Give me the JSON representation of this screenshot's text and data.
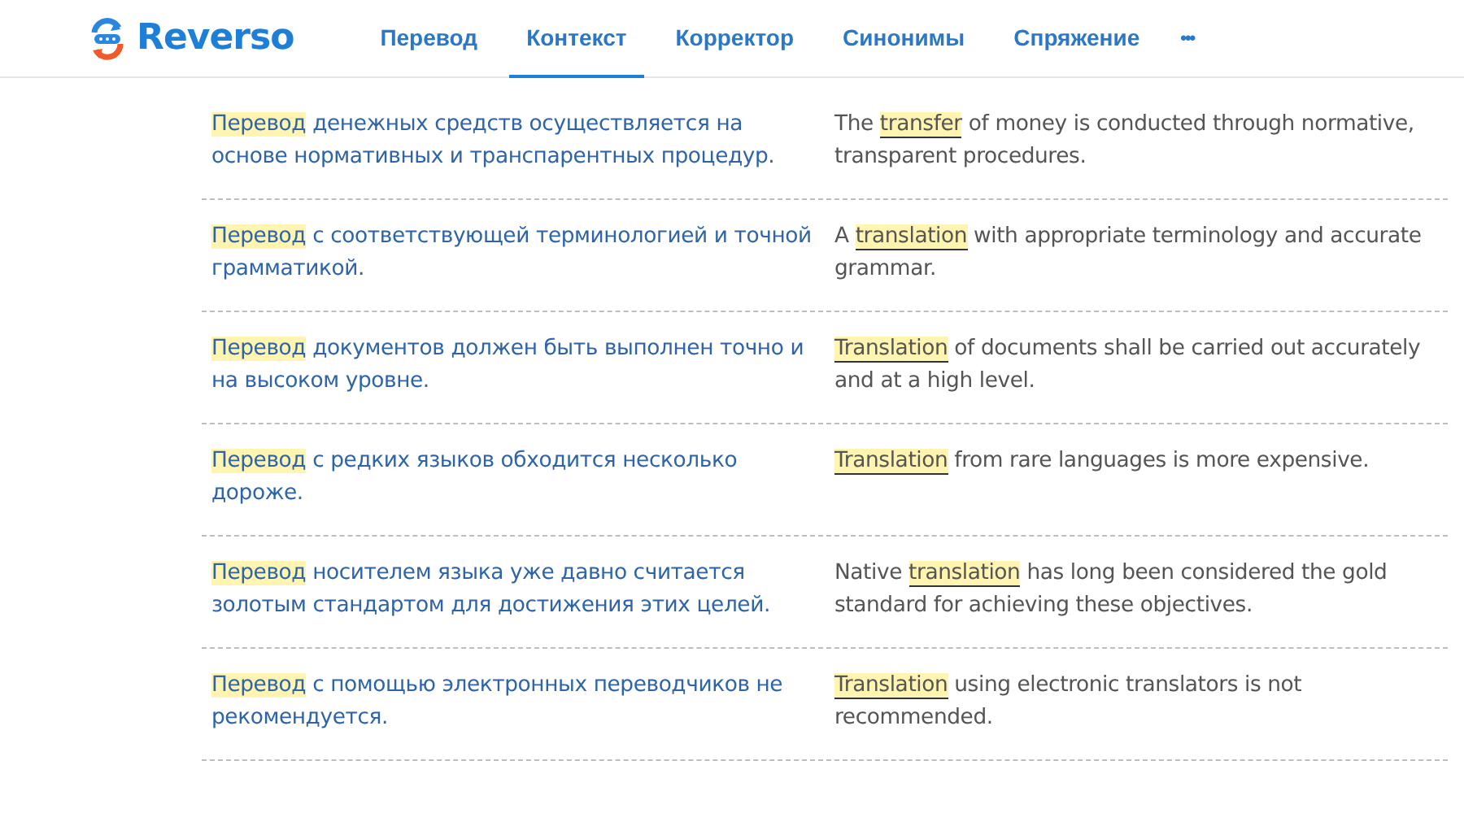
{
  "header": {
    "logo": "Reverso",
    "tabs": [
      {
        "label": "Перевод",
        "selected": false
      },
      {
        "label": "Контекст",
        "selected": true
      },
      {
        "label": "Корректор",
        "selected": false
      },
      {
        "label": "Синонимы",
        "selected": false
      },
      {
        "label": "Спряжение",
        "selected": false
      }
    ],
    "more": "•••"
  },
  "examples": [
    {
      "source": {
        "term": "Перевод",
        "after": " денежных средств осуществляется на основе нормативных и транспарентных процедур."
      },
      "target": {
        "before": "The ",
        "term": "transfer",
        "after": " of money is conducted through normative, transparent procedures."
      }
    },
    {
      "source": {
        "term": "Перевод",
        "after": " с соответствующей терминологией и точной грамматикой."
      },
      "target": {
        "before": "A ",
        "term": "translation",
        "after": " with appropriate terminology and accurate grammar."
      }
    },
    {
      "source": {
        "term": "Перевод",
        "after": " документов должен быть выполнен точно и на высоком уровне."
      },
      "target": {
        "term": "Translation",
        "after": " of documents shall be carried out accurately and at a high level."
      }
    },
    {
      "source": {
        "term": "Перевод",
        "after": " с редких языков обходится несколько дороже."
      },
      "target": {
        "term": "Translation",
        "after": " from rare languages is more expensive."
      }
    },
    {
      "source": {
        "term": "Перевод",
        "after": " носителем языка уже давно считается золотым стандартом для достижения этих целей."
      },
      "target": {
        "before": "Native ",
        "term": "translation",
        "after": " has long been considered the gold standard for achieving these objectives."
      }
    },
    {
      "source": {
        "term": "Перевод",
        "after": " с помощью электронных переводчиков не рекомендуется."
      },
      "target": {
        "term": "Translation",
        "after": " using electronic translators is not recommended."
      }
    }
  ]
}
